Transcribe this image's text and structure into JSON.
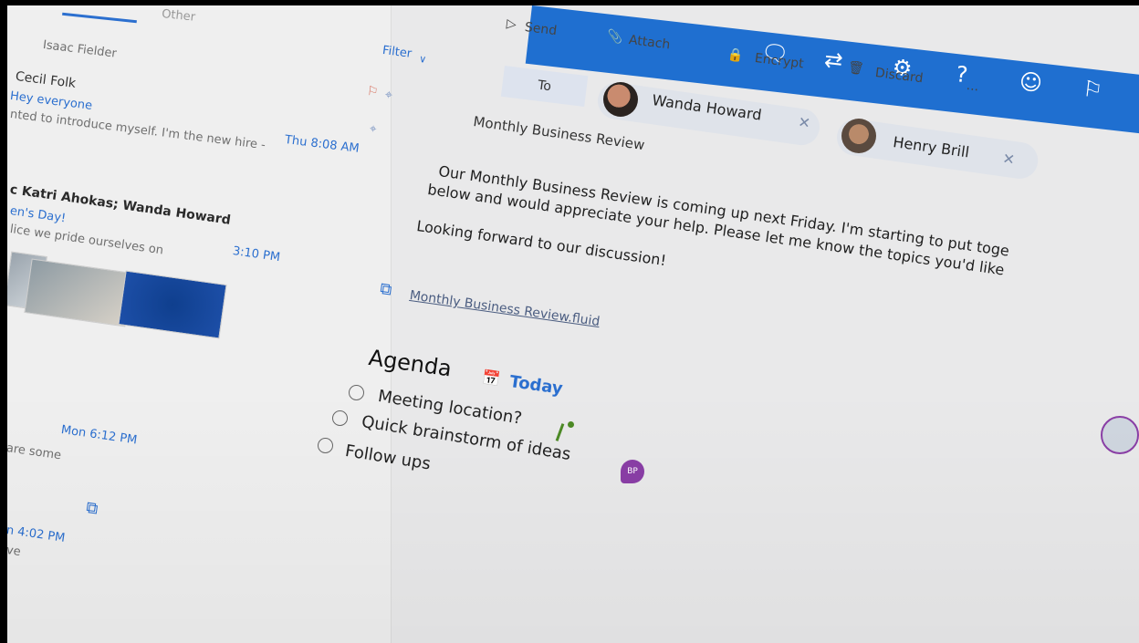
{
  "colors": {
    "accent": "#1f6fd0",
    "link": "#2b6fcf",
    "presence": "#8a3ea6",
    "green_marker": "#4c8a25"
  },
  "message_list": {
    "tabs": [
      "Other"
    ],
    "messages": [
      {
        "sender": "Isaac Fielder"
      },
      {
        "sender": "Cecil Folk",
        "subject": "Hey everyone",
        "preview": "nted to introduce myself. I'm the new hire -",
        "time": "Thu 8:08 AM"
      },
      {
        "sender": "c Katri Ahokas; Wanda Howard",
        "subject": "en's Day!",
        "preview": "lice we pride ourselves on",
        "time": "3:10 PM"
      },
      {
        "preview": "are some",
        "time": "Mon 6:12 PM"
      },
      {
        "time": "n 4:02 PM",
        "preview": "ve"
      }
    ],
    "filter_label": "Filter"
  },
  "toolbar": {
    "send": "Send",
    "attach": "Attach",
    "encrypt": "Encrypt",
    "discard": "Discard",
    "more": "...",
    "icons": [
      "chat-icon",
      "switch-icon",
      "gear-icon",
      "help-icon",
      "smiley-icon",
      "flag-icon"
    ]
  },
  "compose": {
    "to_label": "To",
    "recipients": [
      {
        "name": "Wanda Howard"
      },
      {
        "name": "Henry Brill"
      }
    ],
    "subject": "Monthly Business Review",
    "body_lines": [
      "Our Monthly Business Review is coming up next Friday. I'm starting to put toge",
      "below and would appreciate your help. Please let me know the topics you'd like",
      "Looking forward to our discussion!"
    ],
    "attachment": "Monthly Business Review.fluid",
    "agenda": {
      "title": "Agenda",
      "date_chip": "Today",
      "items": [
        "Meeting location?",
        "Quick brainstorm of ideas",
        "Follow ups"
      ],
      "collaborator_initials": "BP"
    }
  }
}
